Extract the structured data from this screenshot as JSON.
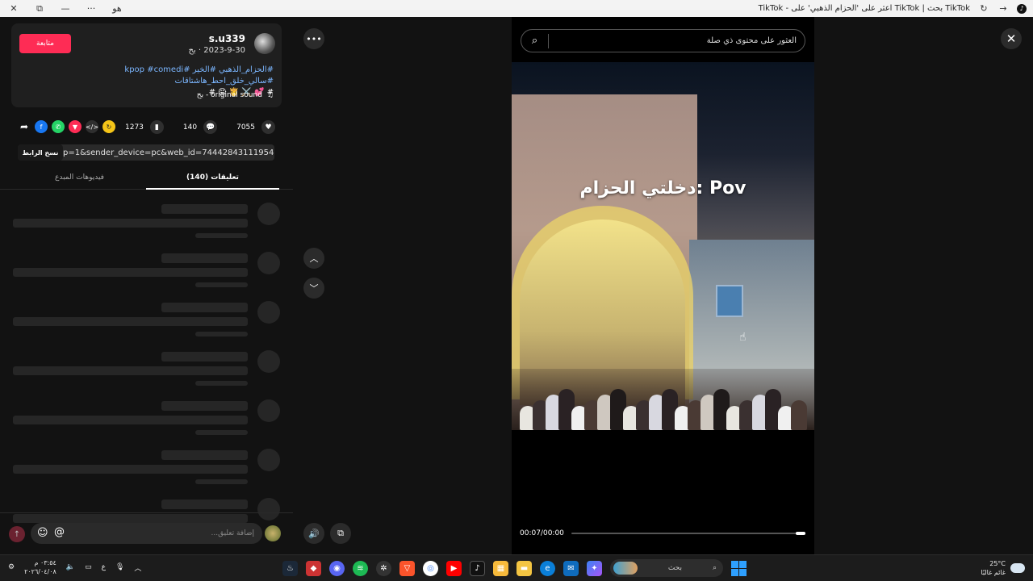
{
  "browser": {
    "tab_title": "TikTok بحث | TikTok اعثر على 'الحزام الذهبي' على - TikTok",
    "translate_label": "ﻫﻮ",
    "more_label": "···",
    "minimize_label": "—",
    "restore_label": "⧉",
    "close_label": "✕",
    "back_label": "→",
    "refresh_label": "↻"
  },
  "author": {
    "username": "s.u339",
    "date": "2023-9-30 · ﺑﺢ",
    "follow_label": "متابعة"
  },
  "caption": {
    "line1": "#الحزام_الذهبي #الخير #kpop #comedi #سالي_خلق_احط_هاشتاقات",
    "line2": "# 💕 ⚔️ 👸 😝 #"
  },
  "sound": {
    "text": "original sound - ﺑﺢ",
    "icon": "♫"
  },
  "stats": {
    "likes": "7055",
    "comments": "140",
    "saves": "1273"
  },
  "share": {
    "link_text": "p=1&sender_device=pc&web_id=7444284311195469320...",
    "copy_label": "نسخ الرابط"
  },
  "tabs": {
    "comments": "تعليقات (140)",
    "creator_videos": "فيديوهات المبدع"
  },
  "comment_box": {
    "placeholder": "إضافة تعليق...",
    "emoji": "☺",
    "mention": "@",
    "post": "↑"
  },
  "video": {
    "search_placeholder": "العثور على محتوى ذي صلة",
    "overlay_text": "دخلتي الحزام: Pov",
    "timecode": "00:07/00:00",
    "progress": 0.04
  },
  "controls": {
    "more": "•••",
    "up": "︿",
    "down": "﹀",
    "volume": "🔊",
    "pip": "⧉",
    "close": "✕"
  },
  "taskbar": {
    "time": "٠٣:٥٤ م",
    "date": "٢٠٢٦/٠٤/٠٨",
    "lang": "ع",
    "search_label": "بحث",
    "weather_temp": "25°C",
    "weather_desc": "غائم غالبًا"
  },
  "colors": {
    "accent": "#fe2c55",
    "link": "#7bb6ff",
    "background": "#121212",
    "card": "#1f1f1f"
  }
}
